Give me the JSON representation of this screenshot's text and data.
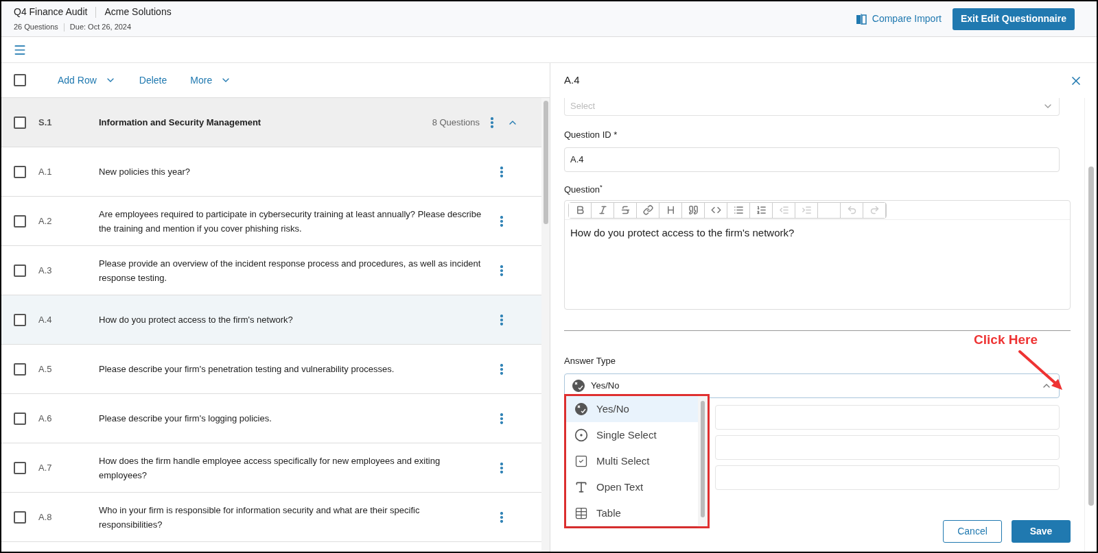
{
  "header": {
    "title": "Q4 Finance Audit",
    "company": "Acme Solutions",
    "count": "26 Questions",
    "due": "Due: Oct 26, 2024",
    "compare": "Compare Import",
    "exit": "Exit Edit Questionnaire"
  },
  "toolbar": {
    "checked": false,
    "actions": [
      {
        "label": "Add Row",
        "dropdown": true
      },
      {
        "label": "Delete",
        "dropdown": false
      },
      {
        "label": "More",
        "dropdown": true
      }
    ]
  },
  "section": {
    "id": "S.1",
    "title": "Information and Security Management",
    "count": "8 Questions",
    "expanded": true,
    "checked": false
  },
  "rows": [
    {
      "id": "A.1",
      "text": "New policies this year?",
      "selected": false,
      "checked": false
    },
    {
      "id": "A.2",
      "text": "Are employees required to participate in cybersecurity training at least annually? Please describe the training and mention if you cover phishing risks.",
      "selected": false,
      "checked": false
    },
    {
      "id": "A.3",
      "text": "Please provide an overview of the incident response process and procedures, as well as incident response testing.",
      "selected": false,
      "checked": false
    },
    {
      "id": "A.4",
      "text": "How do you protect access to the firm's network?",
      "selected": true,
      "checked": false
    },
    {
      "id": "A.5",
      "text": "Please describe your firm's penetration testing and vulnerability processes.",
      "selected": false,
      "checked": false
    },
    {
      "id": "A.6",
      "text": "Please describe your firm's logging policies.",
      "selected": false,
      "checked": false
    },
    {
      "id": "A.7",
      "text": "How does the firm handle employee access specifically for new employees and exiting employees?",
      "selected": false,
      "checked": false
    },
    {
      "id": "A.8",
      "text": "Who in your firm is responsible for information security and what are their specific responsibilities?",
      "selected": false,
      "checked": false
    }
  ],
  "panel": {
    "title": "A.4",
    "select_placeholder": "Select",
    "id_label": "Question ID *",
    "id_value": "A.4",
    "question_label": "Question",
    "question_mark": "*",
    "question_text": "How do you protect access to the firm's network?",
    "editor_tools": [
      {
        "kind": "bold",
        "disabled": false
      },
      {
        "kind": "italic",
        "disabled": false
      },
      {
        "kind": "strike",
        "disabled": false
      },
      {
        "kind": "link",
        "disabled": false
      },
      {
        "kind": "heading",
        "disabled": false
      },
      {
        "kind": "quote",
        "disabled": false
      },
      {
        "kind": "code",
        "disabled": false
      },
      {
        "kind": "bullets",
        "disabled": false
      },
      {
        "kind": "numbers",
        "disabled": false
      },
      {
        "kind": "outdent",
        "disabled": true
      },
      {
        "kind": "indent",
        "disabled": true
      },
      {
        "kind": "blank"
      },
      {
        "kind": "undo",
        "disabled": true
      },
      {
        "kind": "redo",
        "disabled": true
      }
    ],
    "answer_label": "Answer Type",
    "answer_value": "Yes/No",
    "dropdown_open": true,
    "options": [
      {
        "label": "Yes/No",
        "kind": "yesno",
        "selected": true
      },
      {
        "label": "Single Select",
        "kind": "single",
        "selected": false
      },
      {
        "label": "Multi Select",
        "kind": "multi",
        "selected": false
      },
      {
        "label": "Open Text",
        "kind": "text",
        "selected": false
      },
      {
        "label": "Table",
        "kind": "table",
        "selected": false
      }
    ],
    "cancel": "Cancel",
    "save": "Save"
  },
  "annotation": {
    "text": "Click Here"
  }
}
